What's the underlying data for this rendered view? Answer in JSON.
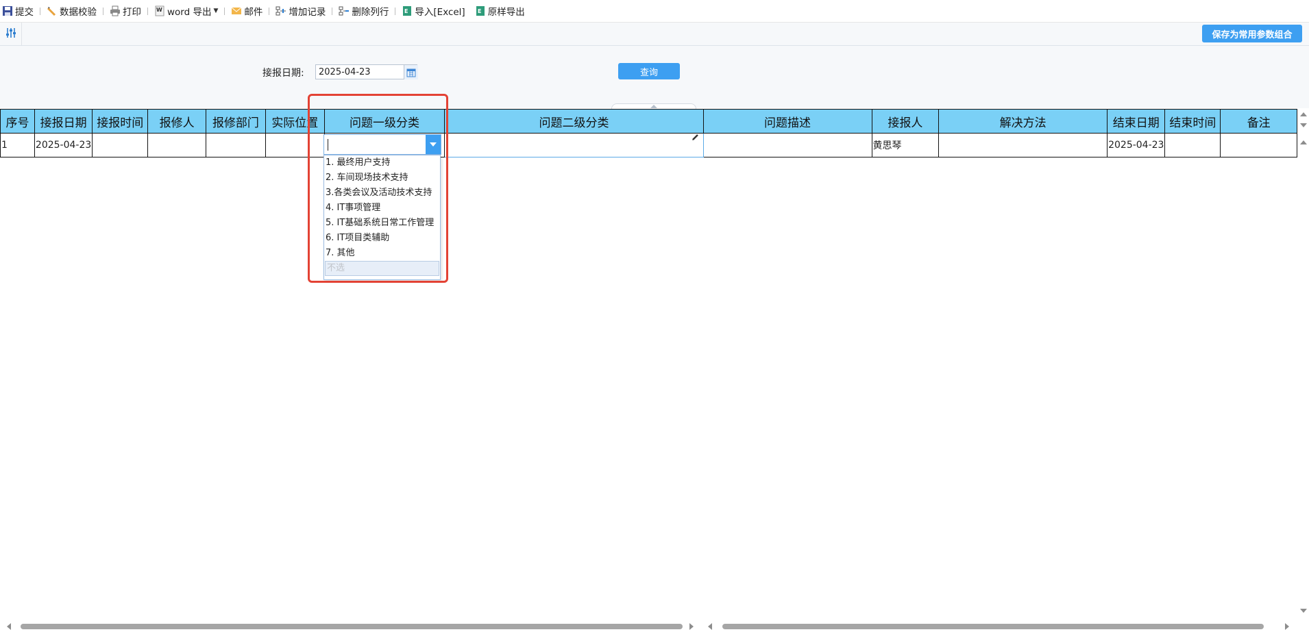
{
  "toolbar": {
    "submit": "提交",
    "validate": "数据校验",
    "print": "打印",
    "word_export": "word 导出",
    "mail": "邮件",
    "add_record": "增加记录",
    "delete_row": "删除列行",
    "import_excel": "导入[Excel]",
    "original_export": "原样导出"
  },
  "subbar": {
    "save_combo": "保存为常用参数组合"
  },
  "query": {
    "date_label": "接报日期:",
    "date_value": "2025-04-23",
    "query_button": "查询"
  },
  "table": {
    "columns": [
      "序号",
      "接报日期",
      "接报时间",
      "报修人",
      "报修部门",
      "实际位置",
      "问题一级分类",
      "问题二级分类",
      "问题描述",
      "接报人",
      "解决方法",
      "结束日期",
      "结束时间",
      "备注"
    ],
    "row": {
      "seq": "1",
      "report_date": "2025-04-23",
      "report_time": "",
      "reporter": "",
      "department": "",
      "location": "",
      "category1": "",
      "category2": "",
      "description": "",
      "receiver": "黄思琴",
      "solution": "",
      "end_date": "2025-04-23",
      "end_time": "",
      "remark": ""
    }
  },
  "dropdown": {
    "options": [
      "1. 最终用户支持",
      "2. 车间现场技术支持",
      "3.各类会议及活动技术支持",
      "4. IT事项管理",
      "5. IT基础系统日常工作管理",
      "6. IT项目类辅助",
      "7. 其他",
      "不选"
    ]
  },
  "colors": {
    "accent": "#3d9ff1",
    "header": "#7ad0f6",
    "highlight": "#e34234"
  }
}
